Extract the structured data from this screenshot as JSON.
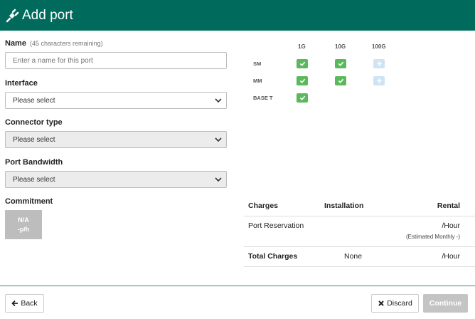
{
  "header": {
    "title": "Add port",
    "icon": "plug-icon"
  },
  "form": {
    "name": {
      "label": "Name",
      "remaining": "(45 characters remaining)",
      "placeholder": "Enter a name for this port",
      "value": ""
    },
    "interface": {
      "label": "Interface",
      "value": "Please select"
    },
    "connector": {
      "label": "Connector type",
      "value": "Please select"
    },
    "bandwidth": {
      "label": "Port Bandwidth",
      "value": "Please select"
    },
    "commitment": {
      "label": "Commitment",
      "line1": "N/A",
      "line2": "-p/h"
    }
  },
  "matrix": {
    "columns": [
      "1G",
      "10G",
      "100G"
    ],
    "rows": [
      {
        "label": "SM",
        "cells": [
          "check",
          "check",
          "plus"
        ]
      },
      {
        "label": "MM",
        "cells": [
          "check",
          "check",
          "plus"
        ]
      },
      {
        "label": "BASE T",
        "cells": [
          "check"
        ]
      }
    ]
  },
  "charges": {
    "headers": {
      "charges": "Charges",
      "installation": "Installation",
      "rental": "Rental"
    },
    "reservation": {
      "label": "Port Reservation",
      "rental": "/Hour",
      "estimate": "(Estimated Monthly -)"
    },
    "total": {
      "label": "Total Charges",
      "installation": "None",
      "rental": "/Hour"
    }
  },
  "footer": {
    "back": "Back",
    "discard": "Discard",
    "continue": "Continue"
  },
  "colors": {
    "header": "#006b5c",
    "check": "#5cb85c",
    "disabled_plus": "#cfe3f3"
  }
}
